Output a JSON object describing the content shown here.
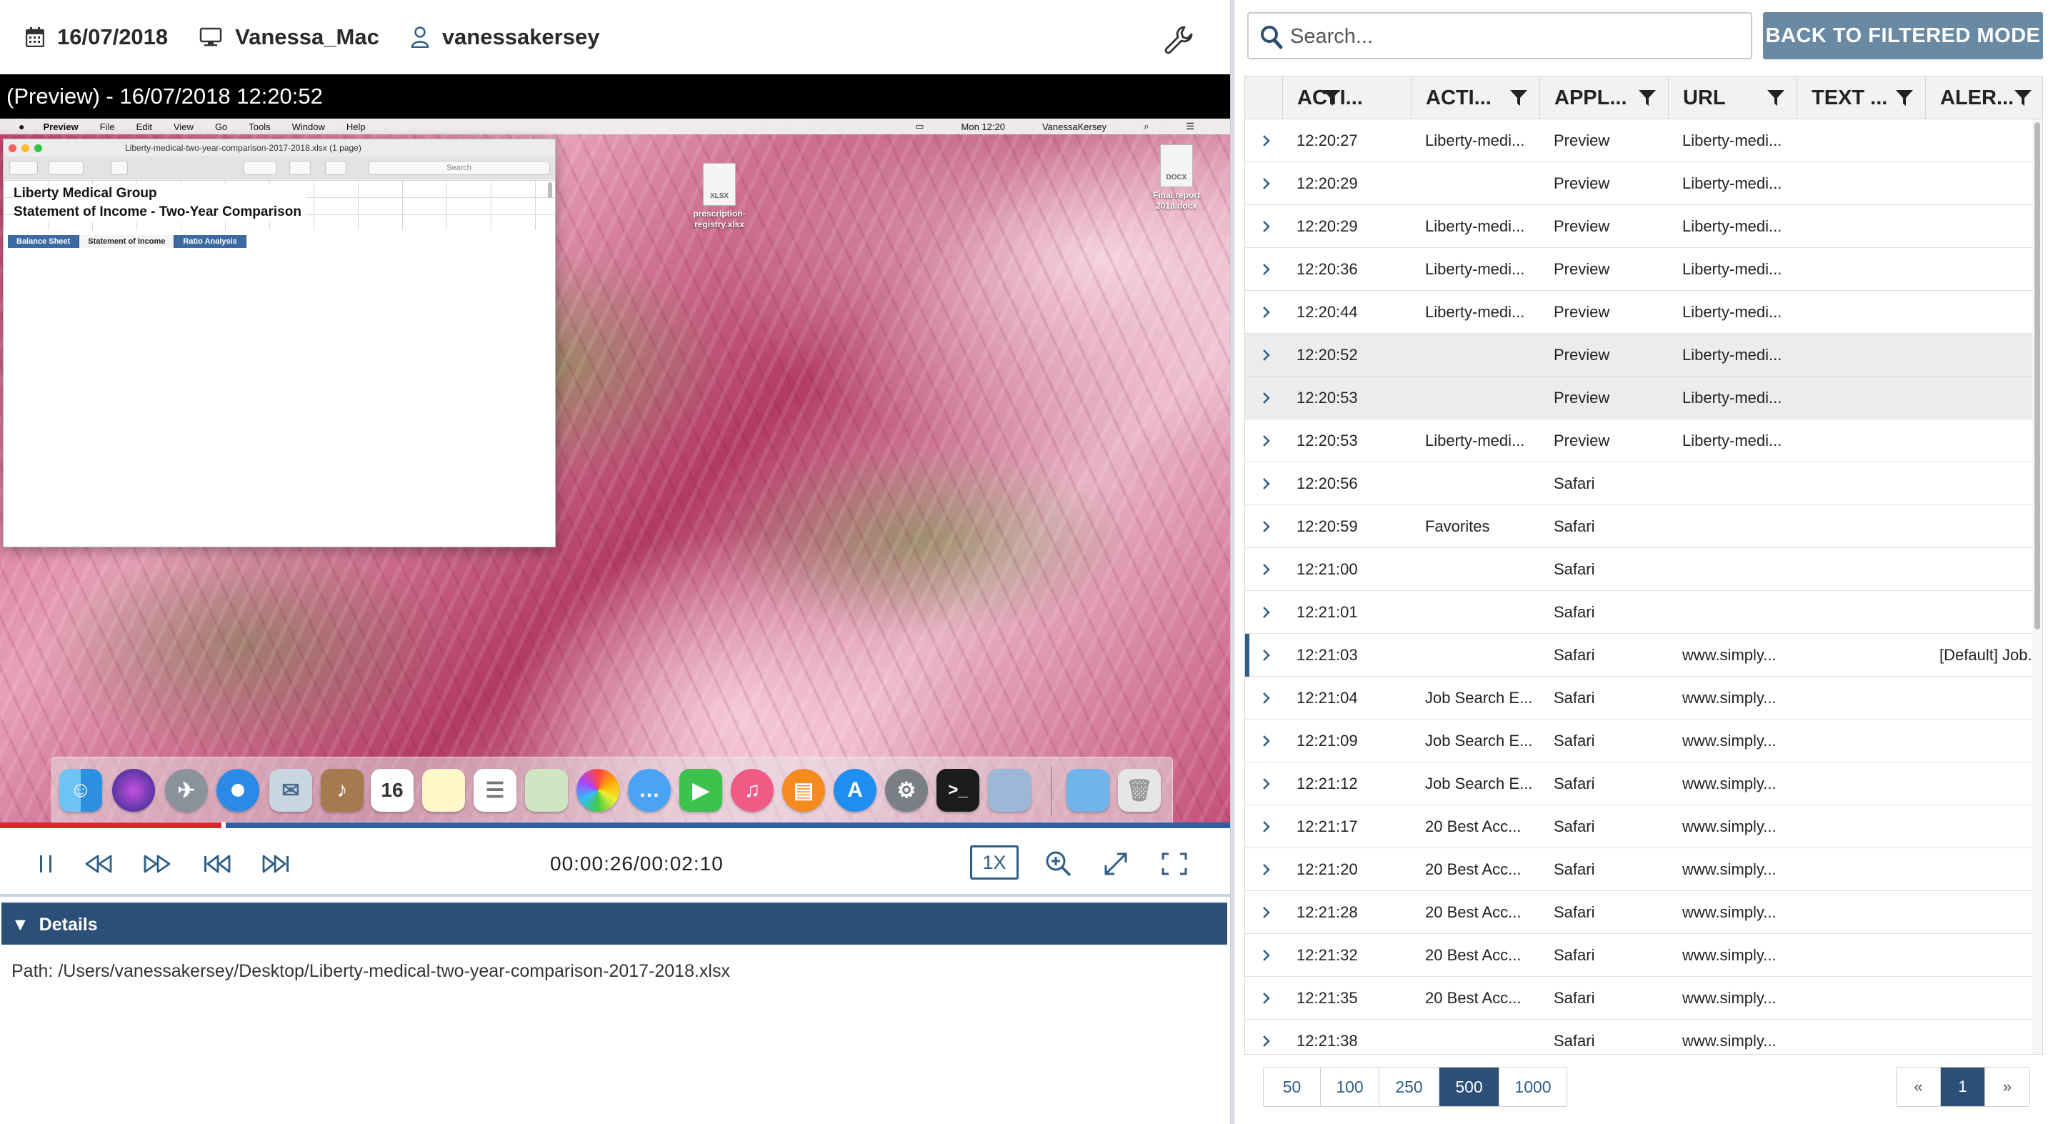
{
  "topbar": {
    "date": "16/07/2018",
    "machine": "Vanessa_Mac",
    "user": "vanessakersey",
    "icons": [
      "calendar-icon",
      "monitor-icon",
      "user-icon",
      "wrench-icon"
    ]
  },
  "player": {
    "title": "(Preview) - 16/07/2018 12:20:52",
    "timecode": "00:00:26/00:02:10",
    "speed": "1X",
    "progress_fraction": 0.18
  },
  "screenshot": {
    "menubar": {
      "app": "Preview",
      "items": [
        "File",
        "Edit",
        "View",
        "Go",
        "Tools",
        "Window",
        "Help"
      ],
      "clock": "Mon 12:20",
      "user": "VanessaKersey"
    },
    "window": {
      "title": "Liberty-medical-two-year-comparison-2017-2018.xlsx (1 page)",
      "search_placeholder": "Search",
      "line1": "Liberty Medical Group",
      "line2": "Statement of Income - Two-Year Comparison",
      "tabs": [
        "Balance Sheet",
        "Statement of Income",
        "Ratio Analysis"
      ]
    },
    "desktop_files": [
      {
        "badge": "XLSX",
        "label": "prescription-registry.xlsx"
      },
      {
        "badge": "DOCX",
        "label": "Final report 2018.docx"
      }
    ],
    "dock_date": "16"
  },
  "details": {
    "header": "Details",
    "path": "Path: /Users/vanessakersey/Desktop/Liberty-medical-two-year-comparison-2017-2018.xlsx"
  },
  "search": {
    "placeholder": "Search..."
  },
  "back_button": "BACK TO FILTERED MODE",
  "table": {
    "columns": [
      "ACTI...",
      "ACTI...",
      "APPL...",
      "URL",
      "TEXT ...",
      "ALER..."
    ],
    "rows": [
      {
        "time": "12:20:27",
        "activity": "Liberty-medi...",
        "app": "Preview",
        "url": "Liberty-medi...",
        "text": "",
        "alert": ""
      },
      {
        "time": "12:20:29",
        "activity": "",
        "app": "Preview",
        "url": "Liberty-medi...",
        "text": "",
        "alert": ""
      },
      {
        "time": "12:20:29",
        "activity": "Liberty-medi...",
        "app": "Preview",
        "url": "Liberty-medi...",
        "text": "",
        "alert": ""
      },
      {
        "time": "12:20:36",
        "activity": "Liberty-medi...",
        "app": "Preview",
        "url": "Liberty-medi...",
        "text": "",
        "alert": ""
      },
      {
        "time": "12:20:44",
        "activity": "Liberty-medi...",
        "app": "Preview",
        "url": "Liberty-medi...",
        "text": "",
        "alert": ""
      },
      {
        "time": "12:20:52",
        "activity": "",
        "app": "Preview",
        "url": "Liberty-medi...",
        "text": "",
        "alert": "",
        "selected": true
      },
      {
        "time": "12:20:53",
        "activity": "",
        "app": "Preview",
        "url": "Liberty-medi...",
        "text": "",
        "alert": "",
        "selected": true
      },
      {
        "time": "12:20:53",
        "activity": "Liberty-medi...",
        "app": "Preview",
        "url": "Liberty-medi...",
        "text": "",
        "alert": ""
      },
      {
        "time": "12:20:56",
        "activity": "",
        "app": "Safari",
        "url": "",
        "text": "",
        "alert": ""
      },
      {
        "time": "12:20:59",
        "activity": "Favorites",
        "app": "Safari",
        "url": "",
        "text": "",
        "alert": ""
      },
      {
        "time": "12:21:00",
        "activity": "",
        "app": "Safari",
        "url": "",
        "text": "",
        "alert": ""
      },
      {
        "time": "12:21:01",
        "activity": "",
        "app": "Safari",
        "url": "",
        "text": "",
        "alert": ""
      },
      {
        "time": "12:21:03",
        "activity": "",
        "app": "Safari",
        "url": "www.simply...",
        "text": "",
        "alert": "[Default] Job...",
        "marked": true
      },
      {
        "time": "12:21:04",
        "activity": "Job Search E...",
        "app": "Safari",
        "url": "www.simply...",
        "text": "",
        "alert": ""
      },
      {
        "time": "12:21:09",
        "activity": "Job Search E...",
        "app": "Safari",
        "url": "www.simply...",
        "text": "",
        "alert": ""
      },
      {
        "time": "12:21:12",
        "activity": "Job Search E...",
        "app": "Safari",
        "url": "www.simply...",
        "text": "",
        "alert": ""
      },
      {
        "time": "12:21:17",
        "activity": "20 Best Acc...",
        "app": "Safari",
        "url": "www.simply...",
        "text": "",
        "alert": ""
      },
      {
        "time": "12:21:20",
        "activity": "20 Best Acc...",
        "app": "Safari",
        "url": "www.simply...",
        "text": "",
        "alert": ""
      },
      {
        "time": "12:21:28",
        "activity": "20 Best Acc...",
        "app": "Safari",
        "url": "www.simply...",
        "text": "",
        "alert": ""
      },
      {
        "time": "12:21:32",
        "activity": "20 Best Acc...",
        "app": "Safari",
        "url": "www.simply...",
        "text": "",
        "alert": ""
      },
      {
        "time": "12:21:35",
        "activity": "20 Best Acc...",
        "app": "Safari",
        "url": "www.simply...",
        "text": "",
        "alert": ""
      },
      {
        "time": "12:21:38",
        "activity": "",
        "app": "Safari",
        "url": "www.simply...",
        "text": "",
        "alert": ""
      }
    ]
  },
  "pager": {
    "sizes": [
      "50",
      "100",
      "250",
      "500",
      "1000"
    ],
    "active_size": "500",
    "prev": "«",
    "page": "1",
    "next": "»"
  },
  "colors": {
    "accent": "#2b4f76",
    "button": "#6a89a3",
    "progress_played": "#e0262a",
    "progress_track": "#2e5ea6"
  }
}
